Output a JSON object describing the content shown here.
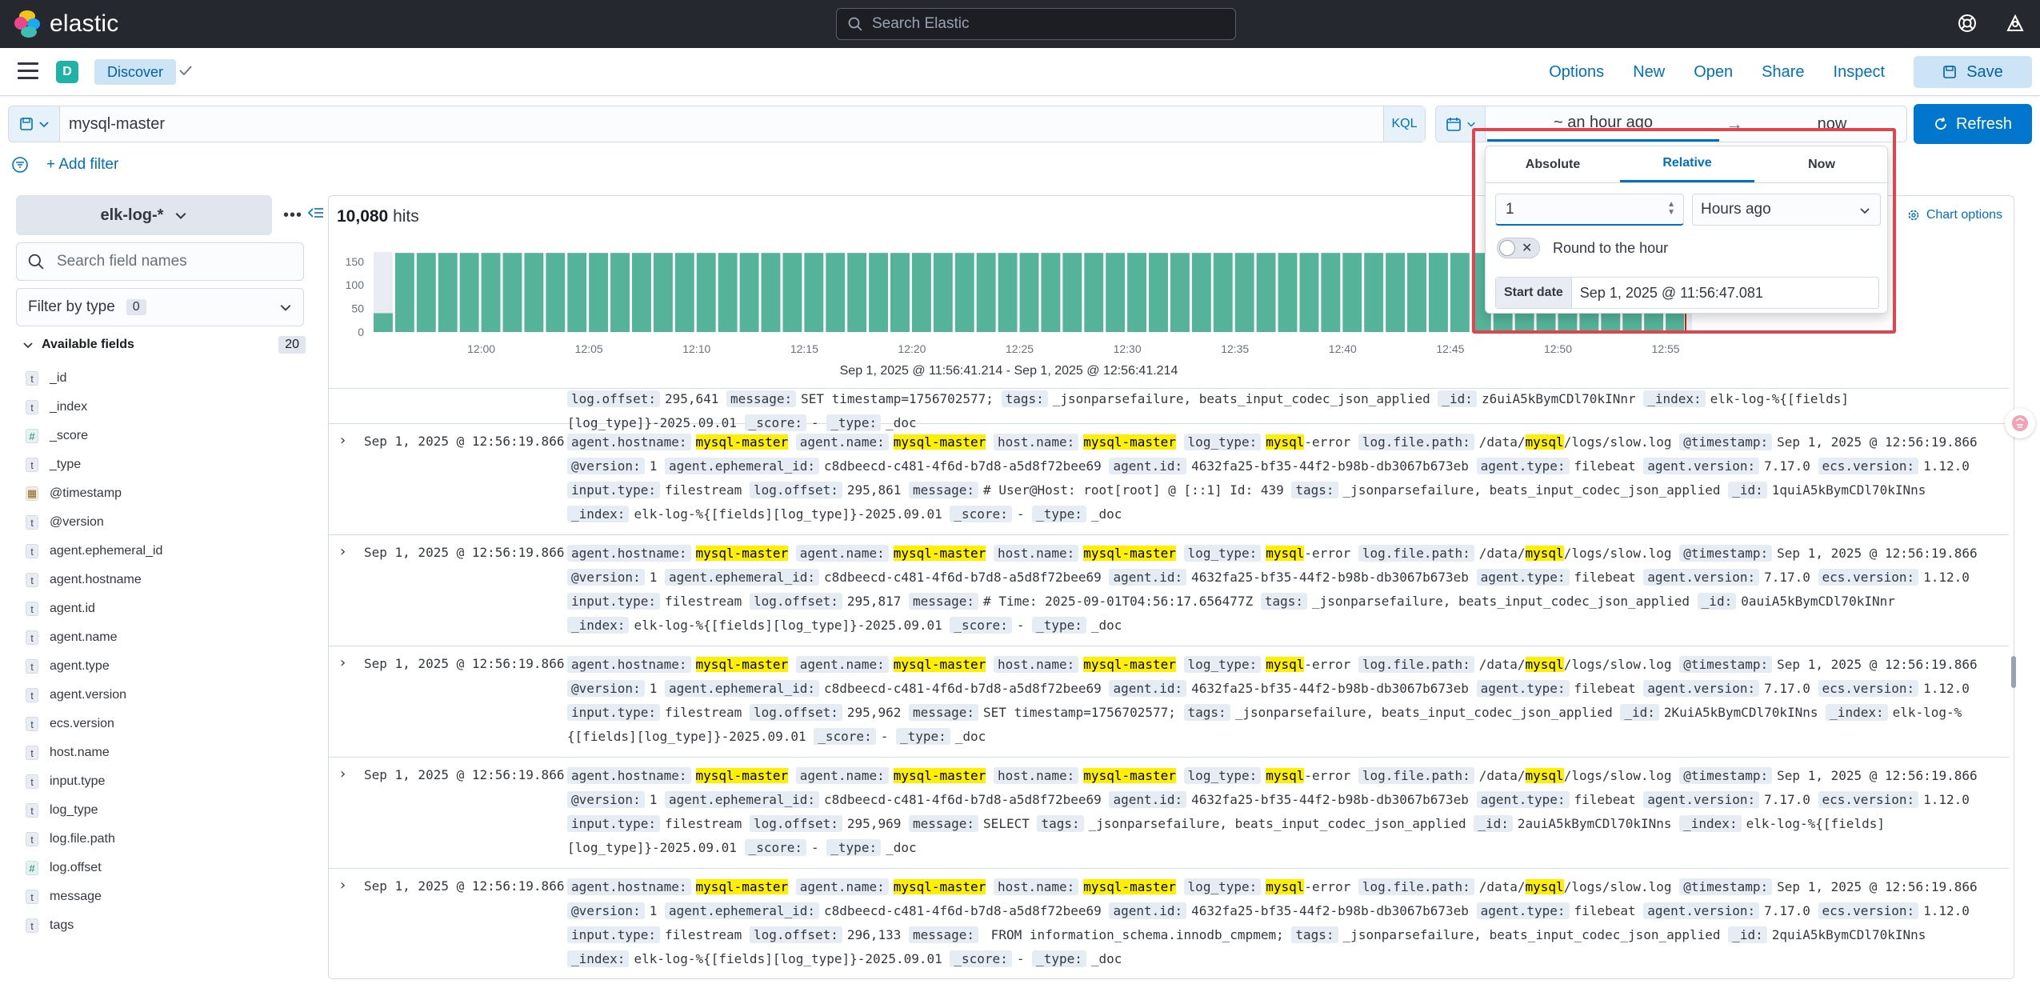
{
  "header": {
    "brand": "elastic",
    "search_placeholder": "Search Elastic"
  },
  "appbar": {
    "space_initial": "D",
    "breadcrumb": "Discover",
    "menu": {
      "options": "Options",
      "new": "New",
      "open": "Open",
      "share": "Share",
      "inspect": "Inspect",
      "save": "Save"
    }
  },
  "query": {
    "text": "mysql-master",
    "language": "KQL"
  },
  "datepicker": {
    "start": "~ an hour ago",
    "arrow": "→",
    "end": "now",
    "refresh": "Refresh"
  },
  "filters": {
    "add_label": "+ Add filter"
  },
  "sidebar": {
    "index_pattern": "elk-log-*",
    "search_placeholder": "Search field names",
    "filter_by_type": "Filter by type",
    "filter_count": "0",
    "available_label": "Available fields",
    "available_count": "20",
    "fields": [
      {
        "type": "t",
        "name": "_id"
      },
      {
        "type": "t",
        "name": "_index"
      },
      {
        "type": "#",
        "name": "_score"
      },
      {
        "type": "t",
        "name": "_type"
      },
      {
        "type": "date",
        "name": "@timestamp"
      },
      {
        "type": "t",
        "name": "@version"
      },
      {
        "type": "t",
        "name": "agent.ephemeral_id"
      },
      {
        "type": "t",
        "name": "agent.hostname"
      },
      {
        "type": "t",
        "name": "agent.id"
      },
      {
        "type": "t",
        "name": "agent.name"
      },
      {
        "type": "t",
        "name": "agent.type"
      },
      {
        "type": "t",
        "name": "agent.version"
      },
      {
        "type": "t",
        "name": "ecs.version"
      },
      {
        "type": "t",
        "name": "host.name"
      },
      {
        "type": "t",
        "name": "input.type"
      },
      {
        "type": "t",
        "name": "log_type"
      },
      {
        "type": "t",
        "name": "log.file.path"
      },
      {
        "type": "#",
        "name": "log.offset"
      },
      {
        "type": "t",
        "name": "message"
      },
      {
        "type": "t",
        "name": "tags"
      }
    ]
  },
  "main": {
    "hits_count": "10,080",
    "hits_label": "hits",
    "chart_options": "Chart options",
    "range_label": "Sep 1, 2025 @ 11:56:41.214 - Sep 1, 2025 @ 12:56:41.214"
  },
  "chart_data": {
    "type": "bar",
    "y_ticks": [
      "150",
      "100",
      "50",
      "0"
    ],
    "ylim": [
      0,
      170
    ],
    "x_ticks": [
      "12:00",
      "12:05",
      "12:10",
      "12:15",
      "12:20",
      "12:25",
      "12:30",
      "12:35",
      "12:40",
      "12:45",
      "12:50",
      "12:55"
    ],
    "bar_count": 61,
    "values": [
      40,
      168,
      168,
      168,
      168,
      168,
      168,
      168,
      168,
      168,
      168,
      168,
      168,
      168,
      168,
      168,
      168,
      168,
      168,
      168,
      168,
      168,
      168,
      168,
      168,
      168,
      168,
      168,
      168,
      168,
      168,
      168,
      168,
      168,
      168,
      168,
      168,
      168,
      168,
      168,
      168,
      168,
      168,
      168,
      168,
      168,
      168,
      168,
      168,
      168,
      168,
      168,
      168,
      168,
      168,
      168,
      168,
      168,
      168,
      168,
      168
    ],
    "bar_color": "#54b399"
  },
  "popover": {
    "tabs": [
      "Absolute",
      "Relative",
      "Now"
    ],
    "active_tab": "Relative",
    "amount": "1",
    "unit": "Hours ago",
    "round_label": "Round to the hour",
    "start_label": "Start date",
    "start_value": "Sep 1, 2025 @ 11:56:47.081"
  },
  "docs_top_partial": {
    "src": [
      {
        "k": "log.offset:",
        "v": "295,641"
      },
      {
        "k": "message:",
        "v": "SET timestamp=1756702577;"
      },
      {
        "k": "tags:",
        "v": "_jsonparsefailure, beats_input_codec_json_applied"
      },
      {
        "k": "_id:",
        "v": "z6uiA5kBymCDl70kINnr"
      },
      {
        "k": "_index:",
        "v": "elk-log-%{[fields][log_type]}-2025.09.01"
      },
      {
        "k": "_score:",
        "v": "-"
      },
      {
        "k": "_type:",
        "v": "_doc"
      }
    ]
  },
  "docs": [
    {
      "timestamp": "Sep 1, 2025 @ 12:56:19.866",
      "ephemeral": "c8dbeecd-c481-4f6d-b7d8-a5d8f72bee69",
      "agent_id": "4632fa25-bf35-44f2-b98b-db3067b673eb",
      "offset": "295,861",
      "message": "# User@Host: root[root] @ [::1] Id: 439",
      "doc_id": "1quiA5kBymCDl70kINns",
      "index": "elk-log-%{[fields][log_type]}-2025.09.01"
    },
    {
      "timestamp": "Sep 1, 2025 @ 12:56:19.866",
      "ephemeral": "c8dbeecd-c481-4f6d-b7d8-a5d8f72bee69",
      "agent_id": "4632fa25-bf35-44f2-b98b-db3067b673eb",
      "offset": "295,817",
      "message": "# Time: 2025-09-01T04:56:17.656477Z",
      "doc_id": "0auiA5kBymCDl70kINnr",
      "index": "elk-log-%{[fields][log_type]}-2025.09.01"
    },
    {
      "timestamp": "Sep 1, 2025 @ 12:56:19.866",
      "ephemeral": "c8dbeecd-c481-4f6d-b7d8-a5d8f72bee69",
      "agent_id": "4632fa25-bf35-44f2-b98b-db3067b673eb",
      "offset": "295,962",
      "message": "SET timestamp=1756702577;",
      "doc_id": "2KuiA5kBymCDl70kINns",
      "index": "elk-log-%{[fields][log_type]}-2025.09.01"
    },
    {
      "timestamp": "Sep 1, 2025 @ 12:56:19.866",
      "ephemeral": "c8dbeecd-c481-4f6d-b7d8-a5d8f72bee69",
      "agent_id": "4632fa25-bf35-44f2-b98b-db3067b673eb",
      "offset": "295,969",
      "message": "SELECT",
      "doc_id": "2auiA5kBymCDl70kINns",
      "index": "elk-log-%{[fields][log_type]}-2025.09.01"
    },
    {
      "timestamp": "Sep 1, 2025 @ 12:56:19.866",
      "ephemeral": "c8dbeecd-c481-4f6d-b7d8-a5d8f72bee69",
      "agent_id": "4632fa25-bf35-44f2-b98b-db3067b673eb",
      "offset": "296,133",
      "message": " FROM information_schema.innodb_cmpmem;",
      "doc_id": "2quiA5kBymCDl70kINns",
      "index": "elk-log-%{[fields][log_type]}-2025.09.01"
    }
  ],
  "doc_common": {
    "hl_word": "mysql",
    "host_suffix": "-master",
    "log_type_suffix": "-error",
    "path_prefix": "/data/",
    "path_suffix": "/logs/slow.log",
    "version": "1",
    "agent_type": "filebeat",
    "agent_version": "7.17.0",
    "ecs_version": "1.12.0",
    "input_type": "filestream",
    "tags": "_jsonparsefailure, beats_input_codec_json_applied",
    "score": "-",
    "type": "_doc",
    "keys": {
      "hostname": "agent.hostname:",
      "agent_name": "agent.name:",
      "host_name": "host.name:",
      "log_type": "log_type:",
      "path": "log.file.path:",
      "timestamp": "@timestamp:",
      "version": "@version:",
      "ephemeral": "agent.ephemeral_id:",
      "agent_id": "agent.id:",
      "agent_type": "agent.type:",
      "agent_version": "agent.version:",
      "ecs": "ecs.version:",
      "input": "input.type:",
      "offset": "log.offset:",
      "message": "message:",
      "tags": "tags:",
      "id": "_id:",
      "index": "_index:",
      "score": "_score:",
      "type": "_type:"
    }
  },
  "colors": {
    "accent": "#0077cc",
    "highlight": "#fef000",
    "popover_outline": "#e0454d",
    "header_bg": "#25282f"
  }
}
